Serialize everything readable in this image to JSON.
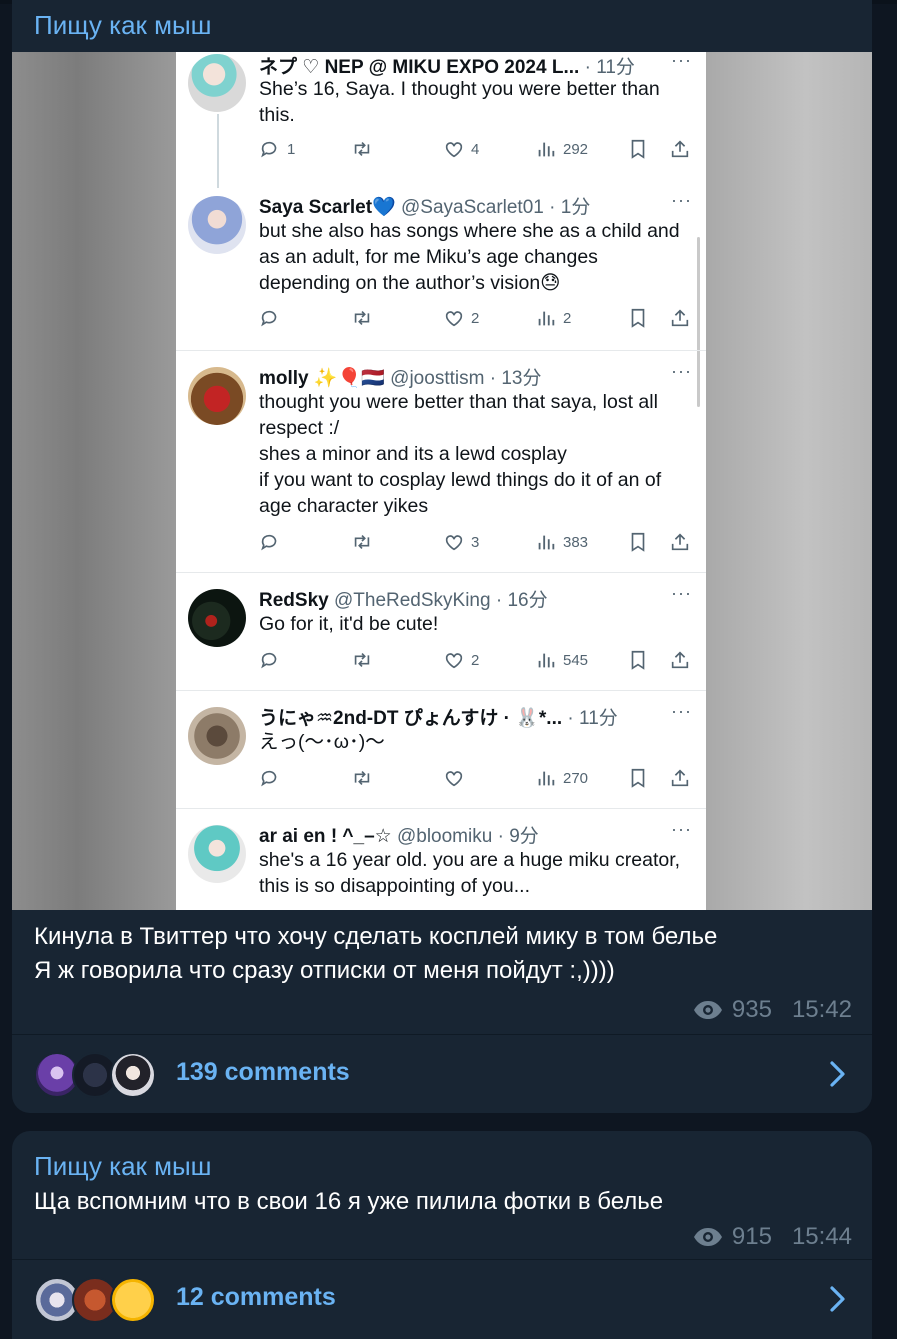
{
  "channel": {
    "name": "Пищу как мыш"
  },
  "post1": {
    "channel_name": "Пищу как мыш",
    "caption_line1": "Кинула в Твиттер что хочу сделать косплей мику в том белье",
    "caption_line2": "Я ж говорила что сразу отписки от меня пойдут :,))))",
    "views": "935",
    "time": "15:42",
    "comments_label": "139 comments"
  },
  "post2": {
    "channel_name": "Пищу как мыш",
    "caption": "Ща вспомним что в свои 16 я уже пилила фотки в белье",
    "views": "915",
    "time": "15:44",
    "comments_label": "12 comments"
  },
  "tweets": [
    {
      "name": "ネプ ♡ NEP @ MIKU EXPO 2024 L...",
      "handle": "",
      "time": "11分",
      "text": "She’s 16, Saya. I thought you were better than this.",
      "replies": "1",
      "likes": "4",
      "views": "292"
    },
    {
      "name": "Saya Scarlet",
      "emoji": "💙",
      "handle": "@SayaScarlet01",
      "time": "1分",
      "text": "but she also has songs where she as a child and as an adult, for me Miku’s age changes depending on the author’s vision😓",
      "replies": "",
      "likes": "2",
      "views": "2"
    },
    {
      "name": "molly",
      "emoji": "✨🎈🇳🇱",
      "handle": "@joosttism",
      "time": "13分",
      "text": "thought you were better than that saya, lost all respect :/\nshes a minor and its a lewd cosplay\nif you want to cosplay lewd things do it of an of age character yikes",
      "replies": "",
      "likes": "3",
      "views": "383"
    },
    {
      "name": "RedSky",
      "handle": "@TheRedSkyKing",
      "time": "16分",
      "text": "Go for it, it'd be cute!",
      "replies": "",
      "likes": "2",
      "views": "545"
    },
    {
      "name": "うにゃ♒2nd-DT ぴょんすけ · 🐰*...",
      "handle": "",
      "time": "11分",
      "text": "えっ(〜･ω･)〜",
      "replies": "",
      "likes": "",
      "views": "270"
    },
    {
      "name": "ar ai en ! ^_–☆",
      "handle": "@bloomiku",
      "time": "9分",
      "text": "she's a 16 year old. you are a huge miku creator, this is so disappointing of you...",
      "replies": "",
      "likes": "",
      "views": ""
    }
  ],
  "colors": {
    "background": "#0e1621",
    "bubble": "#182533",
    "accent": "#6ab3f3",
    "meta": "#6d7f8f"
  },
  "icons": [
    "reply-icon",
    "retweet-icon",
    "like-icon",
    "views-icon",
    "bookmark-icon",
    "share-icon",
    "more-icon",
    "eye-icon",
    "chevron-right-icon"
  ]
}
